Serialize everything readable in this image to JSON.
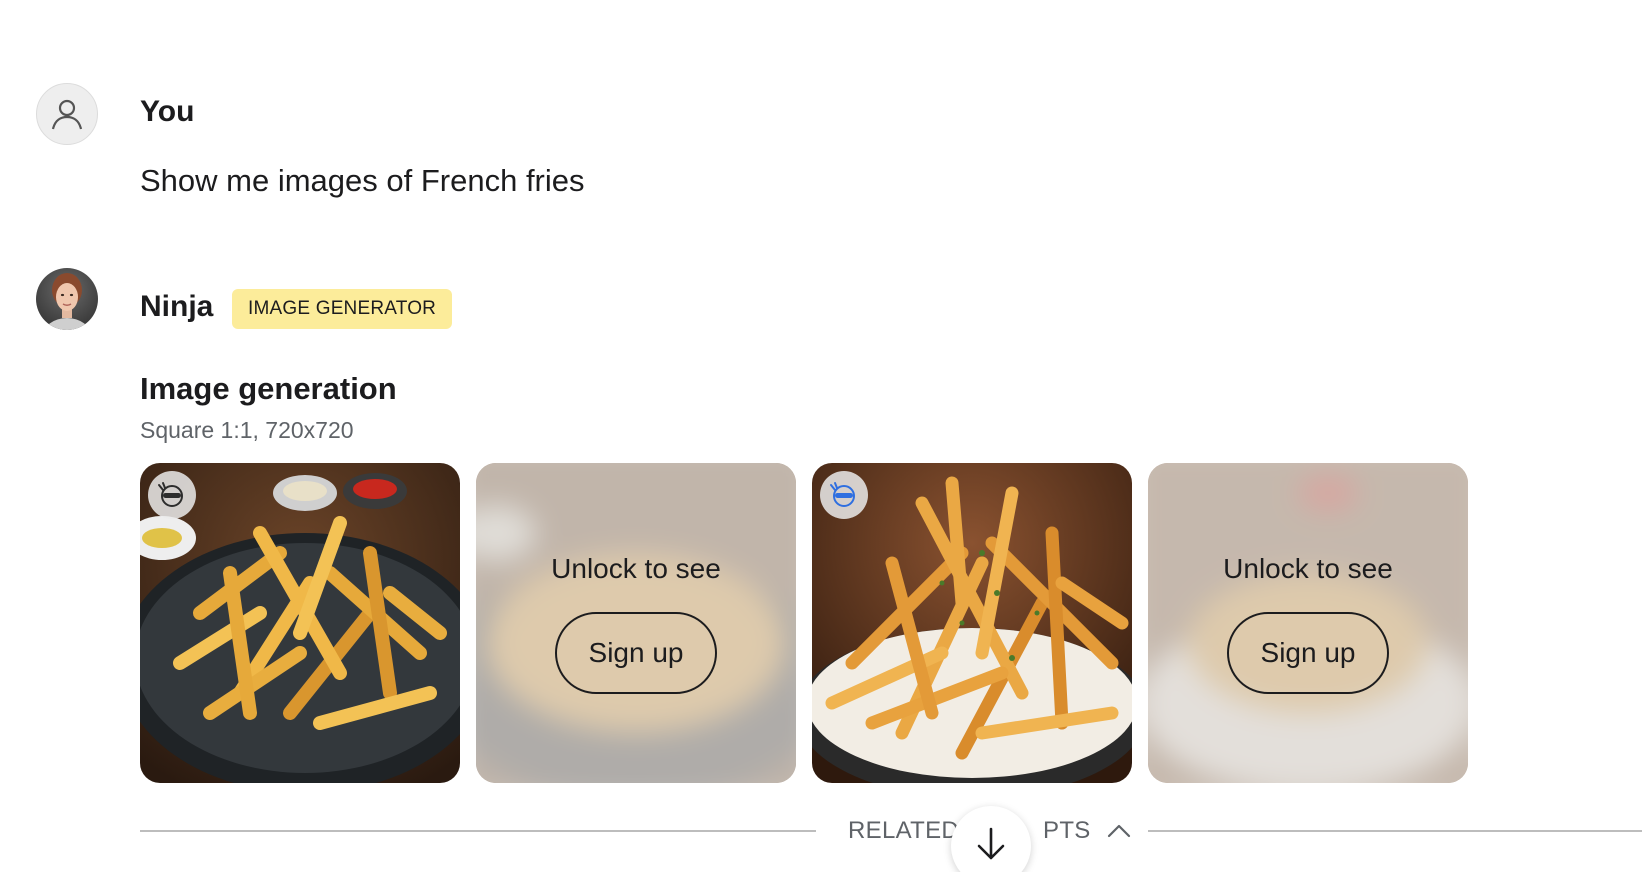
{
  "conversation": {
    "user": {
      "name": "You",
      "avatar_icon": "person-icon",
      "message": "Show me images of French fries"
    },
    "assistant": {
      "name": "Ninja",
      "badge": "IMAGE GENERATOR",
      "badge_color": "#fcec9a",
      "section_title": "Image generation",
      "section_subtitle": "Square 1:1, 720x720",
      "images": [
        {
          "locked": false,
          "icon": "ninja-icon",
          "subject": "French fries"
        },
        {
          "locked": true,
          "unlock_text": "Unlock to see",
          "signup_label": "Sign up"
        },
        {
          "locked": false,
          "icon": "ninja-icon",
          "subject": "French fries"
        },
        {
          "locked": true,
          "unlock_text": "Unlock to see",
          "signup_label": "Sign up"
        }
      ]
    }
  },
  "related": {
    "label_left": "RELATED",
    "label_right": "PTS",
    "toggle_icon": "chevron-up-icon"
  },
  "scroll_button": {
    "icon": "arrow-down-icon"
  }
}
